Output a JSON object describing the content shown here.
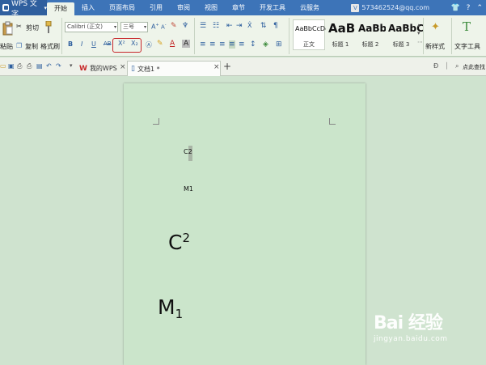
{
  "menubar": {
    "app_name": "WPS 文字",
    "items": [
      "开始",
      "插入",
      "页面布局",
      "引用",
      "审阅",
      "视图",
      "章节",
      "开发工具",
      "云服务"
    ],
    "active_index": 0,
    "account": "573462524@qq.com"
  },
  "ribbon": {
    "paste_label": "粘贴",
    "cut_label": "剪切",
    "copy_label": "复制",
    "format_painter_label": "格式刷",
    "font_name": "Calibri (正文)",
    "font_size": "三号",
    "superscript_label": "X²",
    "subscript_label": "X₂",
    "styles": [
      {
        "sample": "AaBbCcDc",
        "name": "正文"
      },
      {
        "sample": "AaBl",
        "name": "标题 1"
      },
      {
        "sample": "AaBb(",
        "name": "标题 2"
      },
      {
        "sample": "AaBbC",
        "name": "标题 3"
      }
    ],
    "new_style_label": "新样式",
    "text_tools_label": "文字工具",
    "search_label": "点此查找"
  },
  "tabs": {
    "wps_tab_label": "我的WPS",
    "doc_tab_label": "文档1 *"
  },
  "document": {
    "line1_base": "C2",
    "line2_base": "M1",
    "big1_base": "C",
    "big1_sup": "2",
    "big2_base": "M",
    "big2_sub": "1"
  },
  "watermark": {
    "main": "Bai 经验",
    "sub": "jingyan.baidu.com"
  }
}
